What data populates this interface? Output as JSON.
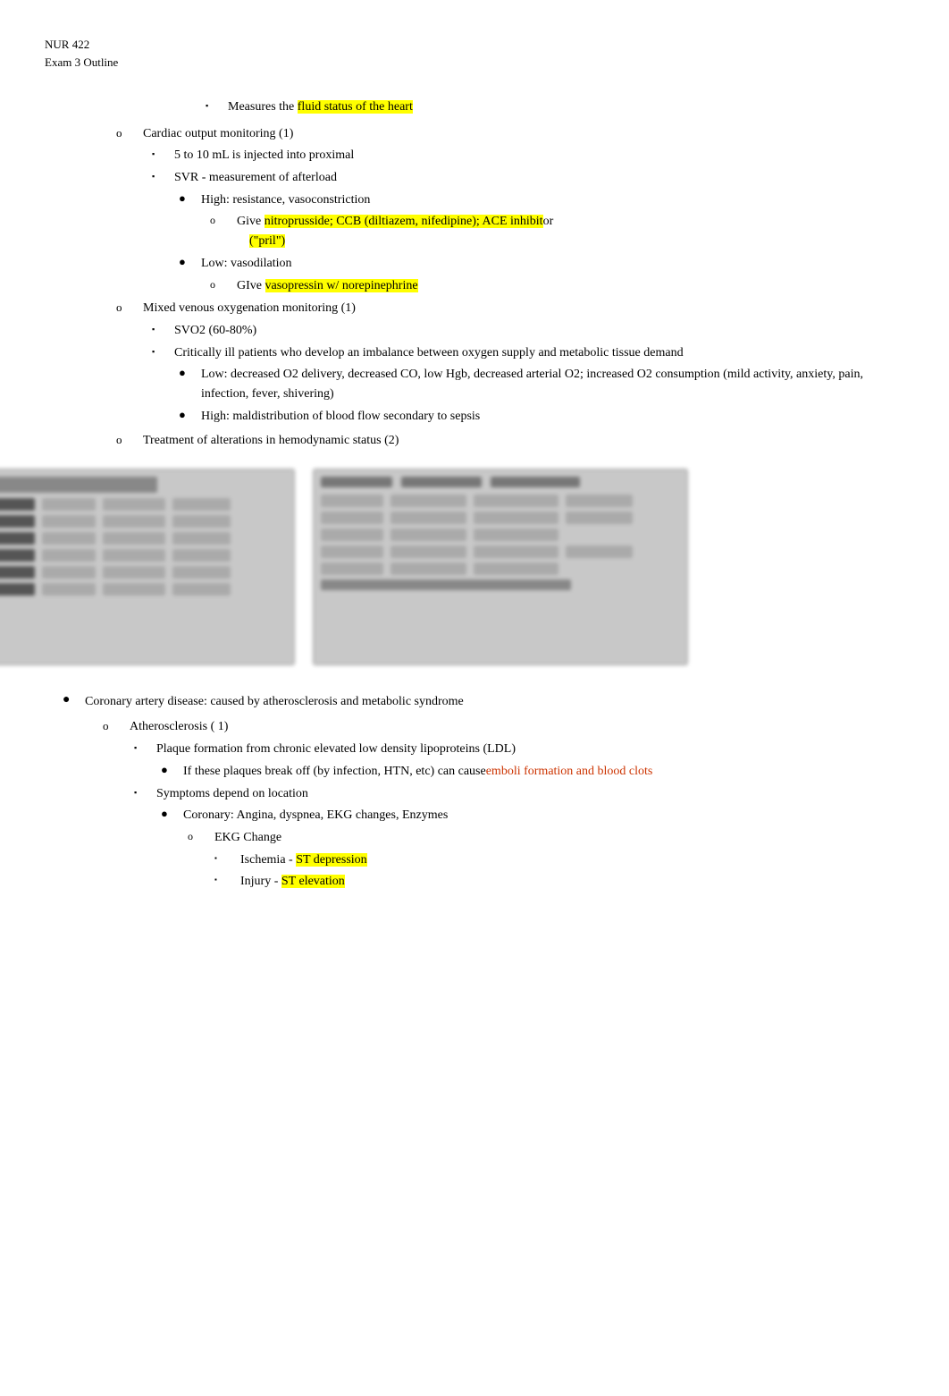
{
  "header": {
    "line1": "NUR 422",
    "line2": "Exam 3 Outline"
  },
  "content": {
    "measures_bullet": {
      "text_before": "Measures the ",
      "text_highlight": "fluid status of the heart",
      "text_after": ""
    },
    "cardiac_output": {
      "label": "Cardiac output monitoring  (1)",
      "items": [
        "5 to 10 mL is injected into proximal",
        "SVR - measurement of afterload"
      ],
      "high_section": {
        "label": "High: resistance, vasoconstriction",
        "give_before": "Give ",
        "give_highlight": "nitroprusside; CCB (diltiazem, nifedipine); ACE inhibit",
        "give_after": "or",
        "give_pril_highlight": "(\"pril\")"
      },
      "low_section": {
        "label": "Low: vasodilation",
        "give_before": "GIve ",
        "give_highlight": "vasopressin w/ norepinephrine"
      }
    },
    "mixed_venous": {
      "label": "Mixed venous oxygenation monitoring   (1)",
      "svo2": "SVO2 (60-80%)",
      "critically_ill": "Critically ill patients who develop an imbalance between oxygen supply and metabolic tissue demand",
      "low_desc": "Low: decreased O2 delivery, decreased CO, low Hgb, decreased arterial O2; increased O2 consumption (mild activity, anxiety, pain, infection, fever, shivering)",
      "high_desc": "High: maldistribution of blood flow secondary to sepsis"
    },
    "treatment": {
      "label": "Treatment of alterations in hemodynamic status     (2)"
    },
    "coronary_artery": {
      "main_label": "Coronary artery disease: caused by atherosclerosis and metabolic syndrome",
      "atherosclerosis": {
        "label": "Atherosclerosis ( 1)",
        "plaque": {
          "text": "Plaque formation from chronic elevated low density lipoproteins (LDL)",
          "if_plaques_before": "If these plaques break off (by infection, HTN, etc) can cause",
          "if_plaques_highlight": "emboli formation and blood clots",
          "if_plaques_highlight_color": "#cc3300"
        },
        "symptoms": {
          "label": "Symptoms depend on location",
          "coronary": {
            "label": "Coronary: Angina, dyspnea, EKG changes, Enzymes",
            "ekg_change": "EKG Change",
            "ischemia_before": "Ischemia - ",
            "ischemia_highlight": "ST depression",
            "injury_before": "Injury - ",
            "injury_highlight": "ST elevation"
          }
        }
      }
    }
  }
}
